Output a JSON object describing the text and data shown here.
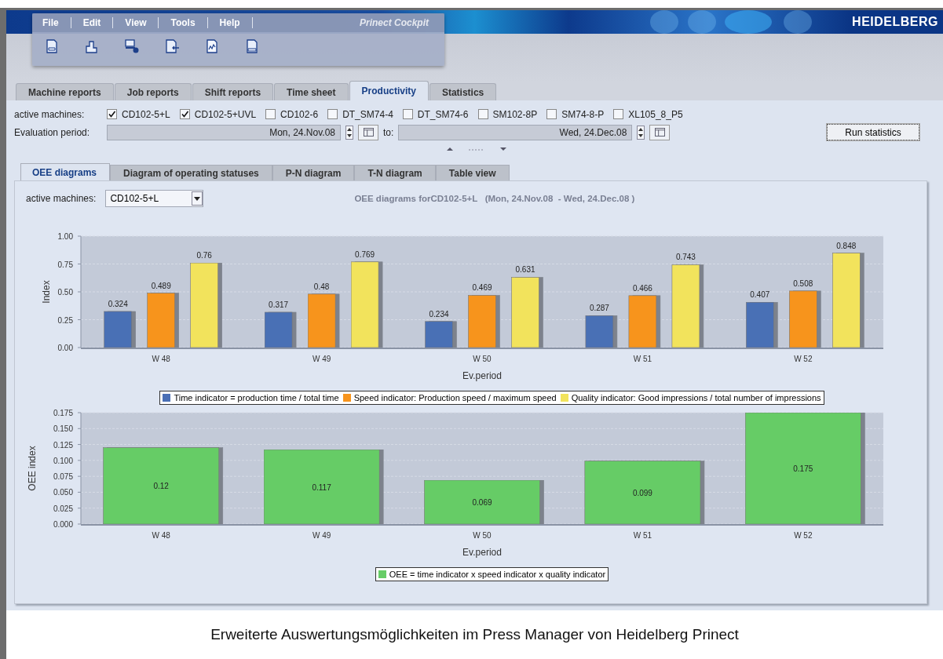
{
  "header": {
    "logo": "HEIDELBERG"
  },
  "menu": {
    "items": [
      "File",
      "Edit",
      "View",
      "Tools",
      "Help"
    ],
    "app_name": "Prinect Cockpit"
  },
  "tabs": [
    {
      "label": "Machine reports",
      "selected": false
    },
    {
      "label": "Job reports",
      "selected": false
    },
    {
      "label": "Shift reports",
      "selected": false
    },
    {
      "label": "Time sheet",
      "selected": false
    },
    {
      "label": "Productivity",
      "selected": true
    },
    {
      "label": "Statistics",
      "selected": false
    }
  ],
  "filters": {
    "machines_label": "active machines:",
    "machines": [
      {
        "name": "CD102-5+L",
        "checked": true
      },
      {
        "name": "CD102-5+UVL",
        "checked": true
      },
      {
        "name": "CD102-6",
        "checked": false
      },
      {
        "name": "DT_SM74-4",
        "checked": false
      },
      {
        "name": "DT_SM74-6",
        "checked": false
      },
      {
        "name": "SM102-8P",
        "checked": false
      },
      {
        "name": "SM74-8-P",
        "checked": false
      },
      {
        "name": "XL105_8_P5",
        "checked": false
      }
    ],
    "period_label": "Evaluation period:",
    "from": "Mon, 24.Nov.08",
    "to_label": "to:",
    "to": "Wed, 24.Dec.08",
    "run_button": "Run statistics"
  },
  "sub_tabs": [
    {
      "label": "OEE diagrams",
      "selected": true
    },
    {
      "label": "Diagram of operating statuses",
      "selected": false
    },
    {
      "label": "P-N diagram",
      "selected": false
    },
    {
      "label": "T-N diagram",
      "selected": false
    },
    {
      "label": "Table view",
      "selected": false
    }
  ],
  "diagram": {
    "machine_label": "active machines:",
    "machine": "CD102-5+L",
    "title": "OEE diagrams forCD102-5+L   (Mon, 24.Nov.08  - Wed, 24.Dec.08 )",
    "charts": [
      {
        "chart_data": {
          "type": "bar",
          "xlabel": "Ev.period",
          "ylabel": "Index",
          "categories": [
            "W 48",
            "W 49",
            "W 50",
            "W 51",
            "W 52"
          ],
          "series": [
            {
              "name": "Time indicator = production time / total time",
              "color": "#4a6fb5",
              "values": [
                0.324,
                0.317,
                0.234,
                0.287,
                0.407
              ]
            },
            {
              "name": "Speed indicator: Production speed / maximum speed",
              "color": "#f7941d",
              "values": [
                0.489,
                0.48,
                0.469,
                0.466,
                0.508
              ]
            },
            {
              "name": "Quality indicator: Good impressions / total number of impressions",
              "color": "#f2e35c",
              "values": [
                0.76,
                0.769,
                0.631,
                0.743,
                0.848
              ]
            }
          ],
          "grid": true,
          "ylim": [
            0,
            1
          ],
          "yticks": [
            {
              "value": 0,
              "label": "0.00"
            },
            {
              "value": 0.25,
              "label": "0.25"
            },
            {
              "value": 0.5,
              "label": "0.50"
            },
            {
              "value": 0.75,
              "label": "0.75"
            },
            {
              "value": 1,
              "label": "1.00"
            }
          ],
          "data_labels": true
        }
      },
      {
        "chart_data": {
          "type": "bar",
          "xlabel": "Ev.period",
          "ylabel": "OEE index",
          "categories": [
            "W 48",
            "W 49",
            "W 50",
            "W 51",
            "W 52"
          ],
          "series": [
            {
              "name": "OEE = time indicator x speed indicator x quality indicator",
              "color": "#66cc66",
              "values": [
                0.12,
                0.117,
                0.069,
                0.099,
                0.175
              ]
            }
          ],
          "grid": true,
          "ylim": [
            0,
            0.175
          ],
          "yticks": [
            {
              "value": 0,
              "label": "0.000"
            },
            {
              "value": 0.025,
              "label": "0.025"
            },
            {
              "value": 0.05,
              "label": "0.050"
            },
            {
              "value": 0.075,
              "label": "0.075"
            },
            {
              "value": 0.1,
              "label": "0.100"
            },
            {
              "value": 0.125,
              "label": "0.125"
            },
            {
              "value": 0.15,
              "label": "0.150"
            },
            {
              "value": 0.175,
              "label": "0.175"
            }
          ],
          "data_labels": true
        }
      }
    ]
  },
  "caption": "Erweiterte Auswertungsmöglichkeiten im Press Manager von Heidelberg Prinect"
}
